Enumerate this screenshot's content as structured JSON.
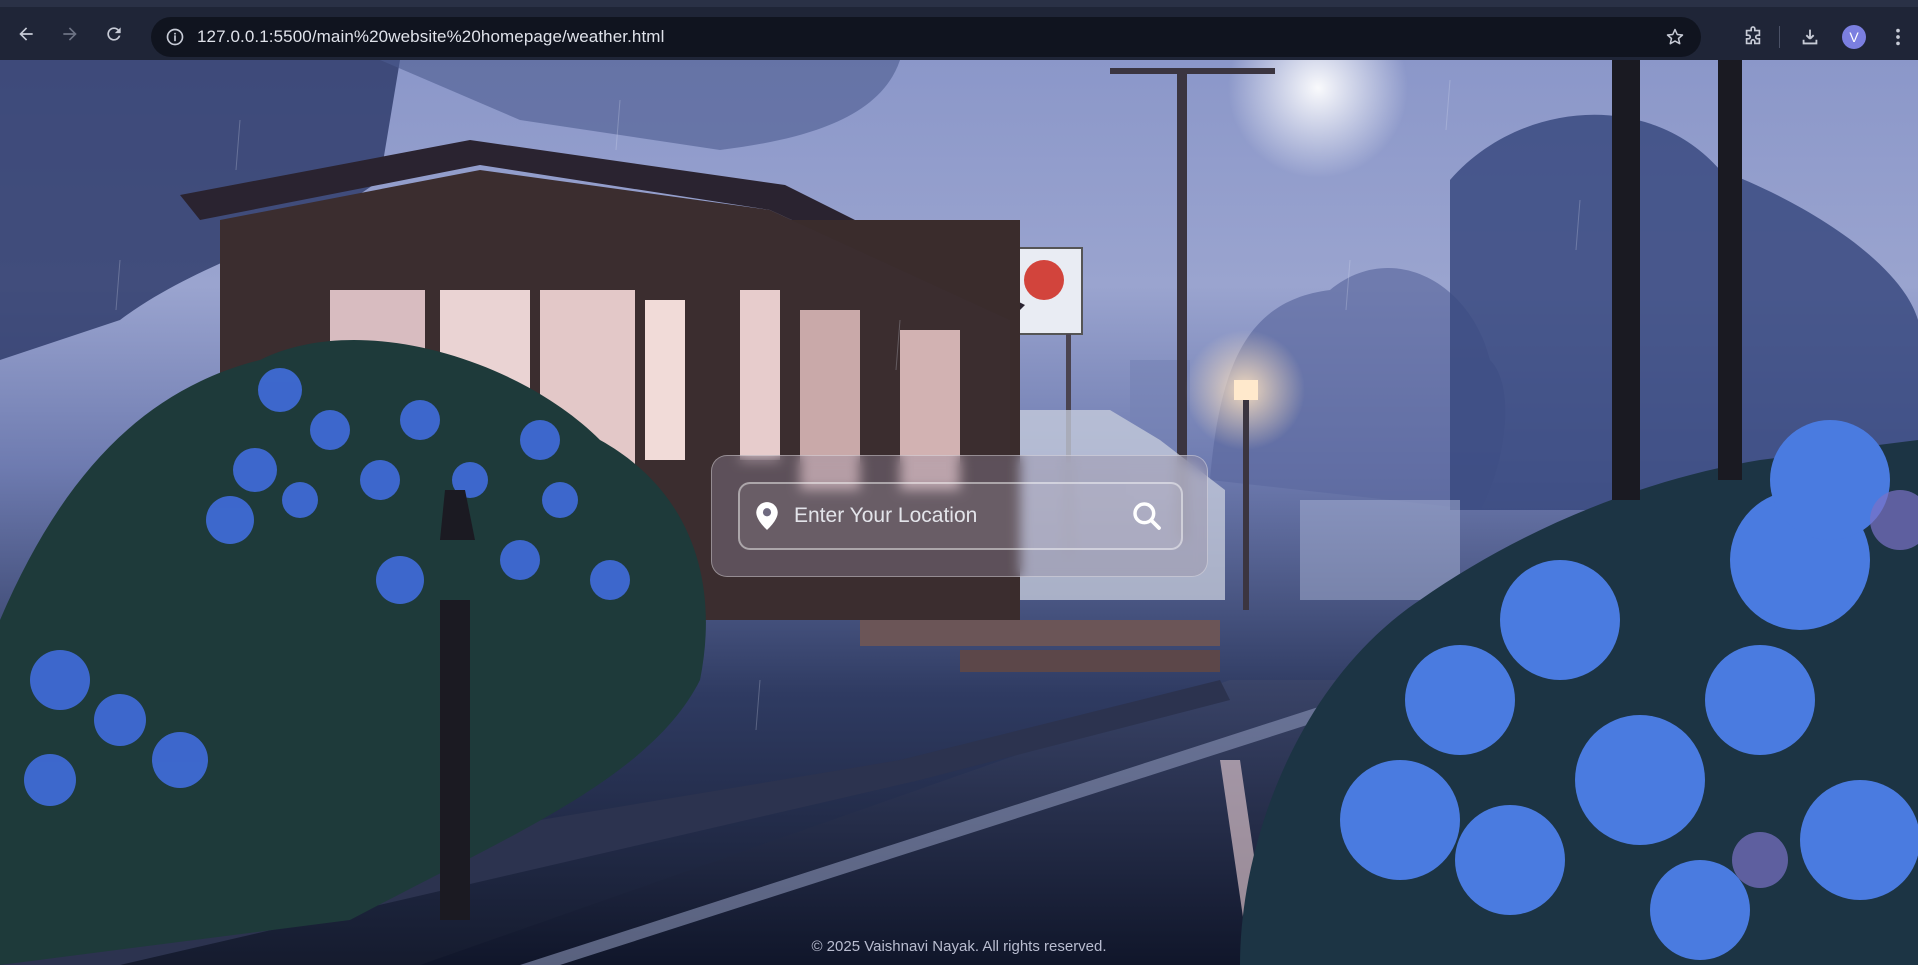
{
  "browser": {
    "url": "127.0.0.1:5500/main%20website%20homepage/weather.html",
    "profile_initial": "V",
    "icons": {
      "back": "arrow-left-icon",
      "forward": "arrow-right-icon",
      "reload": "reload-icon",
      "site_info": "info-icon",
      "bookmark": "star-icon",
      "extensions": "puzzle-icon",
      "downloads": "download-icon",
      "menu": "more-vert-icon"
    }
  },
  "search": {
    "placeholder": "Enter Your Location",
    "value": "",
    "icons": {
      "location": "location-pin-icon",
      "submit": "search-icon"
    }
  },
  "footer": {
    "text": "© 2025 Vaishnavi Nayak. All rights reserved."
  },
  "colors": {
    "chrome_bg": "#1f2537",
    "omnibox_bg": "#10141f",
    "avatar_bg": "#7b7fe0"
  }
}
